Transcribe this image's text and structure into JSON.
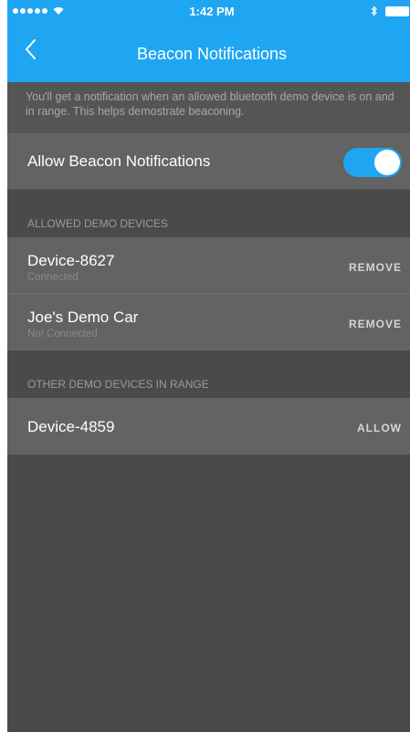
{
  "status_bar": {
    "time": "1:42 PM",
    "signal_icon": "signal-dots-icon",
    "wifi_icon": "wifi-icon",
    "bluetooth_icon": "bluetooth-icon",
    "battery_icon": "battery-icon"
  },
  "nav": {
    "title": "Beacon Notifications",
    "back_icon": "chevron-left-icon"
  },
  "info_text": "You'll get a notification when an allowed bluetooth demo device is on and in range. This helps demostrate beaconing.",
  "toggle": {
    "label": "Allow Beacon Notifications",
    "on": true
  },
  "allowed_section": {
    "header": "ALLOWED DEMO DEVICES",
    "devices": [
      {
        "name": "Device-8627",
        "status": "Connected",
        "action": "REMOVE"
      },
      {
        "name": "Joe's Demo Car",
        "status": "Not Connected",
        "action": "REMOVE"
      }
    ]
  },
  "other_section": {
    "header": "OTHER DEMO DEVICES IN RANGE",
    "devices": [
      {
        "name": "Device-4859",
        "action": "ALLOW"
      }
    ]
  },
  "colors": {
    "accent": "#1ea6f3",
    "background": "#4a4a4a",
    "row": "#636363"
  }
}
